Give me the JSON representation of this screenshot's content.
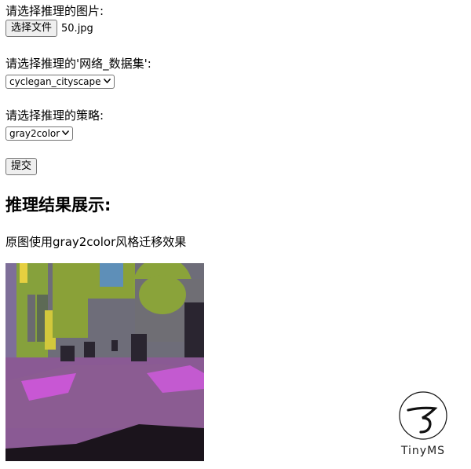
{
  "form": {
    "image_label": "请选择推理的图片:",
    "choose_file_button": "选择文件",
    "file_name": "50.jpg",
    "network_label": "请选择推理的'网络_数据集':",
    "network_selected": "cyclegan_cityscape",
    "strategy_label": "请选择推理的策略:",
    "strategy_selected": "gray2color",
    "submit_button": "提交"
  },
  "result": {
    "heading": "推理结果展示:",
    "caption": "原图使用gray2color风格迁移效果"
  },
  "logo": {
    "text": "TinyMS"
  },
  "icons": {
    "dropdown": "chevron-down-icon"
  }
}
